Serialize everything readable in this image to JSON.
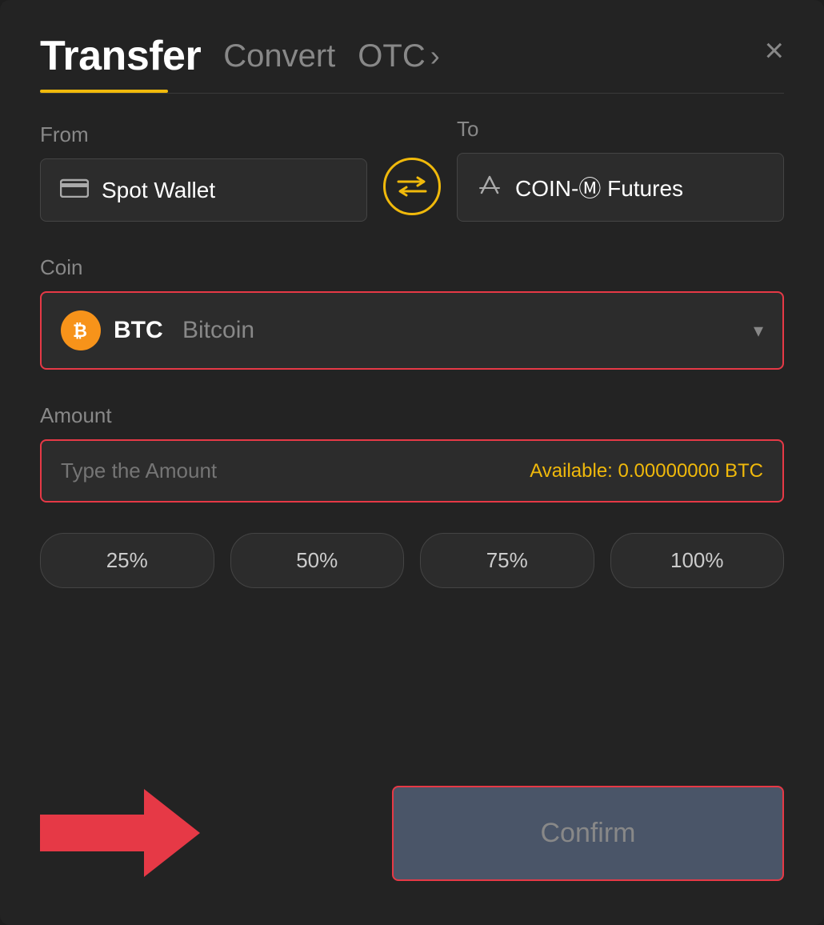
{
  "header": {
    "title": "Transfer",
    "convert_label": "Convert",
    "otc_label": "OTC",
    "otc_chevron": "›",
    "close_icon": "×"
  },
  "from": {
    "label": "From",
    "wallet_icon": "▬",
    "wallet_label": "Spot Wallet"
  },
  "swap": {
    "icon": "⇄"
  },
  "to": {
    "label": "To",
    "wallet_icon": "↑",
    "wallet_label": "COIN-Ⓜ Futures"
  },
  "coin": {
    "label": "Coin",
    "symbol": "BTC",
    "name": "Bitcoin",
    "chevron": "▾"
  },
  "amount": {
    "label": "Amount",
    "placeholder": "Type the Amount",
    "available_label": "Available:",
    "available_value": "0.00000000 BTC"
  },
  "percentages": [
    {
      "label": "25%"
    },
    {
      "label": "50%"
    },
    {
      "label": "75%"
    },
    {
      "label": "100%"
    }
  ],
  "confirm": {
    "label": "Confirm"
  }
}
